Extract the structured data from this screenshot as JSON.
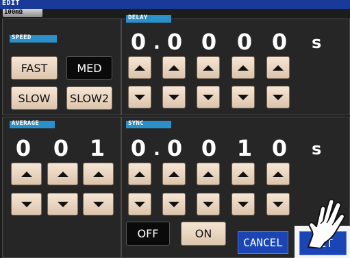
{
  "title": "EDIT",
  "range_tab": "100mΩ",
  "speed": {
    "tag": "SPEED",
    "buttons": [
      "FAST",
      "MED",
      "SLOW",
      "SLOW2"
    ],
    "selected": "MED"
  },
  "delay": {
    "tag": "DELAY",
    "digits": [
      "0",
      "0",
      "0",
      "0",
      "0"
    ],
    "dot": ".",
    "unit": "s"
  },
  "average": {
    "tag": "AVERAGE",
    "digits": [
      "0",
      "0",
      "1"
    ]
  },
  "sync": {
    "tag": "SYNC",
    "digits": [
      "0",
      "0",
      "0",
      "1",
      "0"
    ],
    "dot": ".",
    "unit": "s",
    "toggle": [
      "OFF",
      "ON"
    ],
    "selected": "OFF"
  },
  "actions": {
    "cancel": "CANCEL",
    "set": "SET"
  },
  "colors": {
    "title_bar": "#1a3a9a",
    "tag": "#2b8fc9",
    "button_face": "#f0dcc6",
    "selected_button": "#0a0a0a",
    "action_button": "#1b45b5"
  },
  "icons": {
    "up": "triangle-up-icon",
    "down": "triangle-down-icon",
    "pointer": "pointing-hand-icon"
  }
}
